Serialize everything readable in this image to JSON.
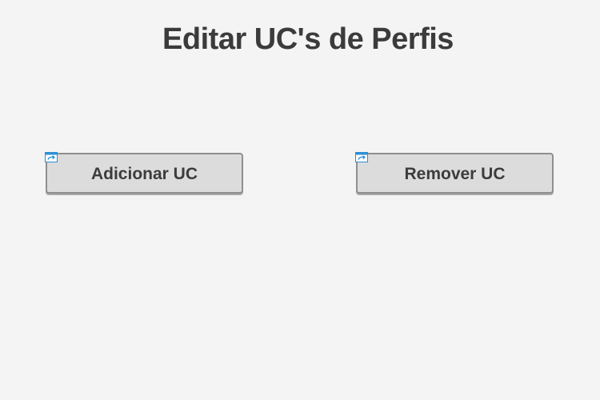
{
  "page": {
    "title": "Editar UC's de Perfis"
  },
  "buttons": {
    "add": {
      "label": "Adicionar UC",
      "icon": "interaction-link-icon"
    },
    "remove": {
      "label": "Remover UC",
      "icon": "interaction-link-icon"
    }
  },
  "colors": {
    "background": "#f4f4f4",
    "button_fill": "#dcdcdc",
    "button_border": "#8f8f8f",
    "text": "#3b3b3b",
    "link_icon": "#2e8fd6"
  }
}
